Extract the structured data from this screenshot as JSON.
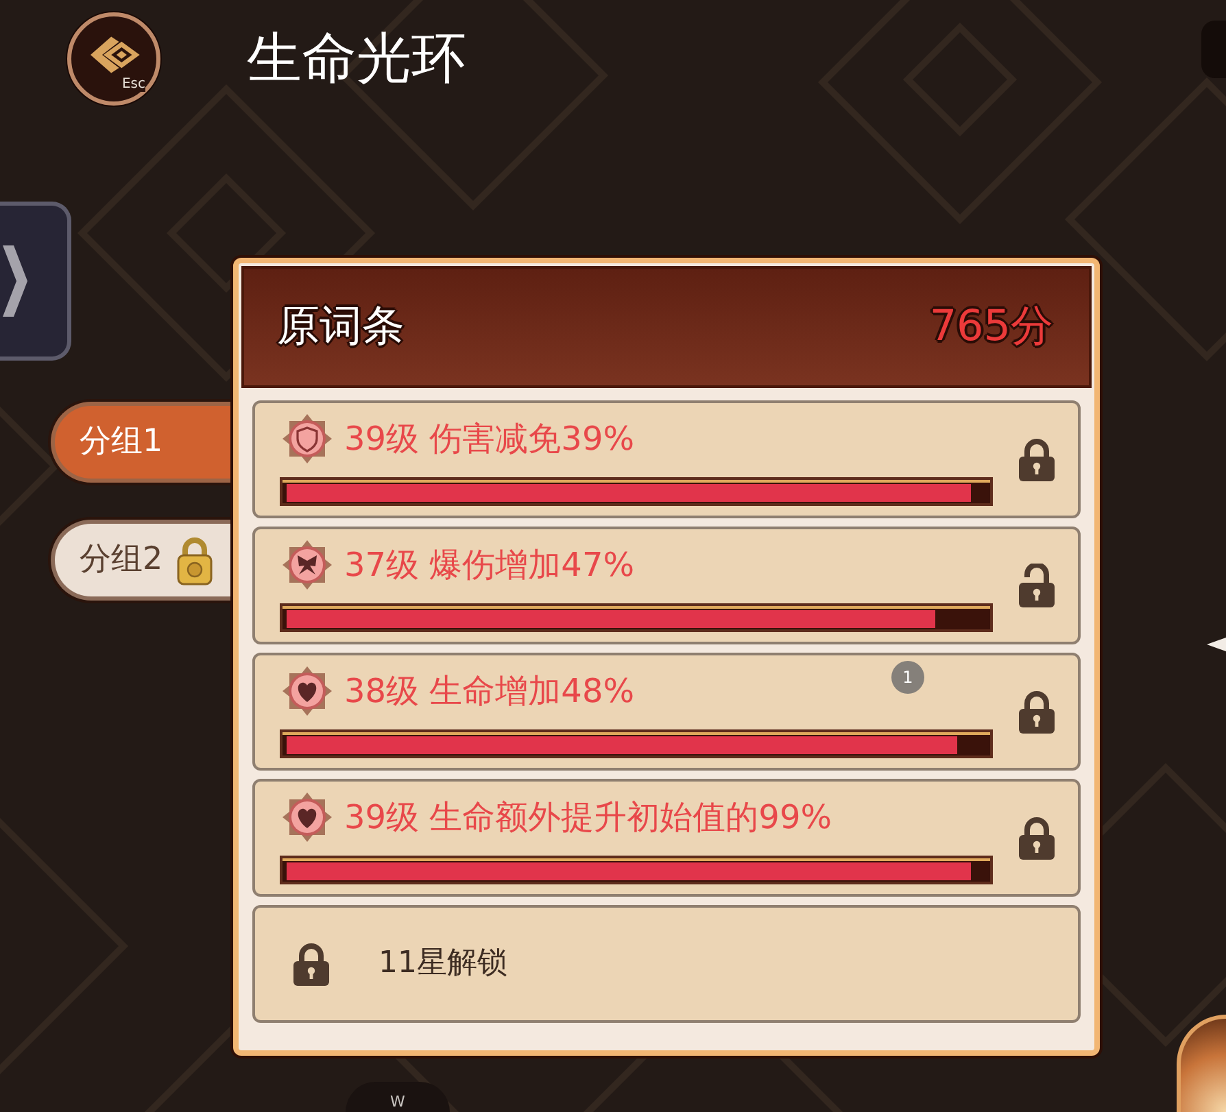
{
  "header": {
    "back_button": {
      "key": "Esc"
    },
    "title": "生命光环"
  },
  "groups": [
    {
      "label": "分组1",
      "selected": true,
      "locked": false
    },
    {
      "label": "分组2",
      "selected": false,
      "locked": true
    }
  ],
  "panel": {
    "title": "原词条",
    "score": "765分",
    "rows": [
      {
        "kind": "defense",
        "text": "39级 伤害减免39%",
        "level": 0.98,
        "locked": true
      },
      {
        "kind": "crit",
        "text": "37级 爆伤增加47%",
        "level": 0.93,
        "locked": false
      },
      {
        "kind": "health",
        "text": "38级 生命增加48%",
        "level": 0.96,
        "locked": true,
        "badge": "1"
      },
      {
        "kind": "health",
        "text": "39级 生命额外提升初始值的99%",
        "level": 0.98,
        "locked": true
      },
      {
        "kind": "unlock",
        "text": "11星解锁",
        "locked": true
      }
    ]
  },
  "key_hint": "W"
}
